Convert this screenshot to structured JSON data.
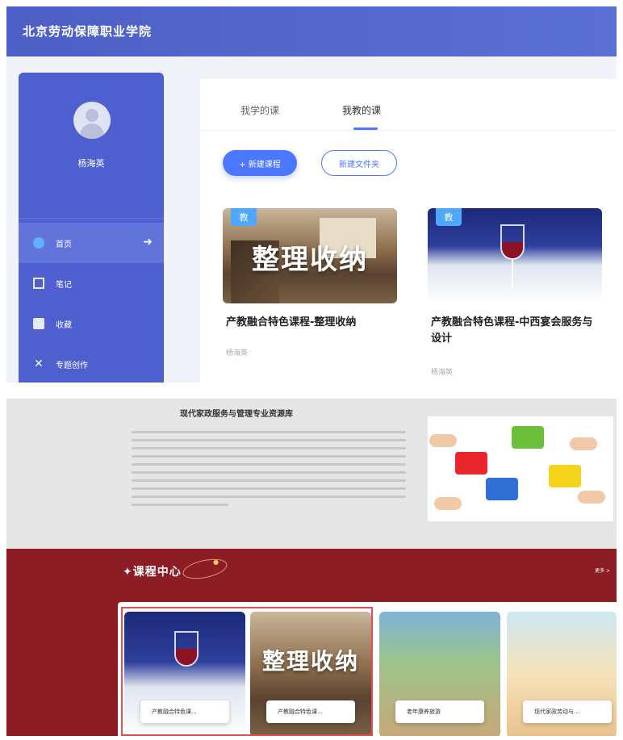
{
  "app": {
    "school_name": "北京劳动保障职业学院"
  },
  "sidebar": {
    "username": "杨海英",
    "items": [
      {
        "label": "首页",
        "icon": "home-icon",
        "active": true
      },
      {
        "label": "笔记",
        "icon": "note-icon",
        "active": false
      },
      {
        "label": "收藏",
        "icon": "bookmark-icon",
        "active": false
      },
      {
        "label": "专题创作",
        "icon": "create-icon",
        "active": false
      }
    ]
  },
  "tabs": [
    {
      "label": "我学的课",
      "active": false
    },
    {
      "label": "我教的课",
      "active": true
    }
  ],
  "toolbar": {
    "new_course_label": "+ 新建课程",
    "new_folder_label": "新建文件夹"
  },
  "courses": [
    {
      "badge": "教",
      "image_text": "整理收纳",
      "title": "产教融合特色课程-整理收纳",
      "teacher": "杨海英"
    },
    {
      "badge": "教",
      "image_text": "",
      "title": "产教融合特色课程-中西宴会服务与设计",
      "teacher": "杨海英"
    }
  ],
  "about": {
    "title": "现代家政服务与管理专业资源库"
  },
  "course_center": {
    "title": "✦课程中心",
    "more": "更多 >",
    "cards": [
      {
        "label": "产教融合特色课...",
        "image_text": ""
      },
      {
        "label": "产教融合特色课...",
        "image_text": "整理收纳"
      },
      {
        "label": "老年康养旅游",
        "image_text": ""
      },
      {
        "label": "现代家政劳动与...",
        "image_text": ""
      }
    ]
  },
  "colors": {
    "primary": "#4b78ff",
    "header": "#4d5fc6",
    "sidebar": "#4e5fcf",
    "course_center_bg": "#8c1d24"
  }
}
